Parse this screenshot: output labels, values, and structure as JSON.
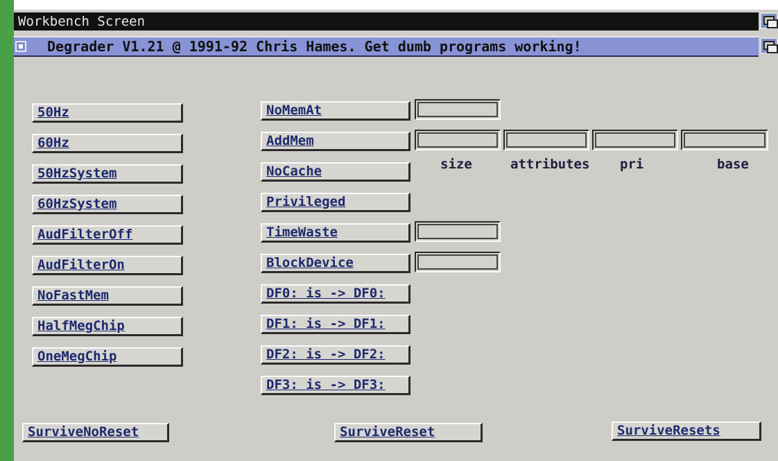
{
  "screen": {
    "title": "Workbench Screen"
  },
  "window": {
    "title": "Degrader V1.21 @ 1991-92 Chris Hames.  Get dumb programs working!"
  },
  "left_buttons": [
    "50Hz",
    "60Hz",
    "50HzSystem",
    "60HzSystem",
    "AudFilterOff",
    "AudFilterOn",
    "NoFastMem",
    "HalfMegChip",
    "OneMegChip"
  ],
  "mid_buttons": [
    "NoMemAt",
    "AddMem",
    "NoCache",
    "Privileged",
    "TimeWaste",
    "BlockDevice",
    "DF0: is -> DF0:",
    "DF1: is -> DF1:",
    "DF2: is -> DF2:",
    "DF3: is -> DF3:"
  ],
  "fields": {
    "nomemat": "",
    "addmem_size": "",
    "addmem_attributes": "",
    "addmem_pri": "",
    "addmem_base": "",
    "timewaste": "",
    "blockdevice": ""
  },
  "addmem_labels": {
    "size": "size",
    "attributes": "attributes",
    "pri": "pri",
    "base": "base"
  },
  "bottom_buttons": [
    "SurviveNoReset",
    "SurviveReset",
    "SurviveResets"
  ]
}
